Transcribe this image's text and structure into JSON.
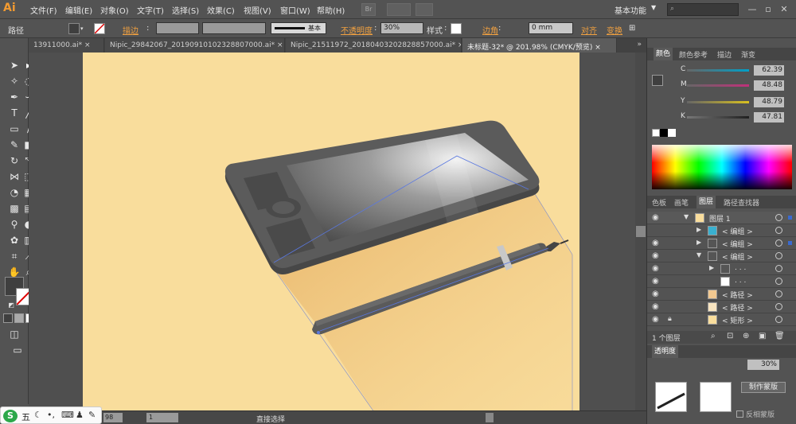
{
  "app": {
    "logo": "Ai"
  },
  "menu": {
    "items": [
      "文件(F)",
      "编辑(E)",
      "对象(O)",
      "文字(T)",
      "选择(S)",
      "效果(C)",
      "视图(V)",
      "窗口(W)",
      "帮助(H)"
    ],
    "br_label": "Br",
    "workspace": "基本功能",
    "search_placeholder": ""
  },
  "control": {
    "object_type": "路径",
    "stroke_label": "描边",
    "stroke_style": "基本",
    "opacity_label": "不透明度",
    "opacity_value": "30%",
    "style_label": "样式",
    "corner_label": "边角",
    "corner_value": "0 mm",
    "align_label": "对齐",
    "transform_label": "变换"
  },
  "tabs": [
    {
      "label": "13911000.ai* ×",
      "active": false
    },
    {
      "label": "Nipic_29842067_20190910102328807000.ai* ×",
      "active": false
    },
    {
      "label": "Nipic_21511972_20180403202828857000.ai* ×",
      "active": false
    },
    {
      "label": "未标题-32* @ 201.98% (CMYK/预览) ×",
      "active": true
    }
  ],
  "status": {
    "zoom": "98",
    "page": "1",
    "tool": "直接选择"
  },
  "color_panel": {
    "tabs": [
      "颜色",
      "颜色参考",
      "描边",
      "渐变"
    ],
    "channels": [
      {
        "name": "C",
        "value": "62.39",
        "color": "#00a0c8"
      },
      {
        "name": "M",
        "value": "48.48",
        "color": "#c0307a"
      },
      {
        "name": "Y",
        "value": "48.79",
        "color": "#d8c020"
      },
      {
        "name": "K",
        "value": "47.81",
        "color": "#202020"
      }
    ]
  },
  "layers_panel": {
    "tabs": [
      "色板",
      "画笔",
      "图层",
      "路径查找器"
    ],
    "rows": [
      {
        "label": "图层 1",
        "indent": 0,
        "visible": true,
        "expanded": true,
        "selected": true
      },
      {
        "label": "< 编组 >",
        "indent": 1,
        "visible": false,
        "expanded": false
      },
      {
        "label": "< 编组 >",
        "indent": 1,
        "visible": true,
        "expanded": false
      },
      {
        "label": "< 编组 >",
        "indent": 1,
        "visible": true,
        "expanded": true
      },
      {
        "label": ". . .",
        "indent": 2,
        "visible": true,
        "expanded": false
      },
      {
        "label": ". . .",
        "indent": 2,
        "visible": true,
        "expanded": false
      },
      {
        "label": "< 路径 >",
        "indent": 1,
        "visible": true,
        "expanded": false
      },
      {
        "label": "< 路径 >",
        "indent": 1,
        "visible": true,
        "expanded": false
      },
      {
        "label": "< 矩形 >",
        "indent": 1,
        "visible": true,
        "expanded": false
      }
    ],
    "footer": "1 个图层"
  },
  "transparency_panel": {
    "tab": "透明度",
    "value": "30%",
    "make_mask": "制作蒙版",
    "invert_mask": "反相蒙版"
  },
  "ime": {
    "mode": "五"
  },
  "colors": {
    "artboard": "#f9dd9c",
    "tablet": "#5b5b5b",
    "accent": "#f29a30"
  }
}
